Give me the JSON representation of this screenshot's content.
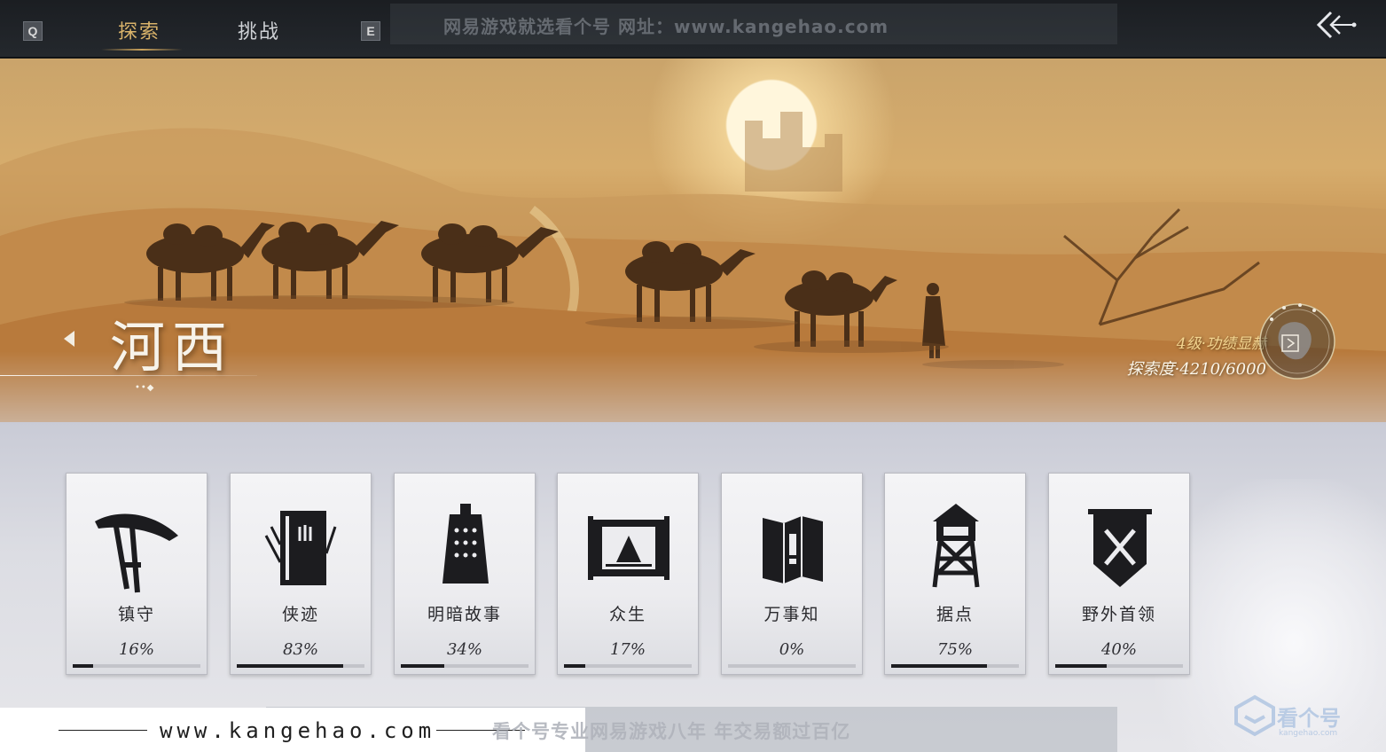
{
  "topbar": {
    "key_left": "Q",
    "key_right": "E",
    "tabs": [
      {
        "label": "探索",
        "active": true
      },
      {
        "label": "挑战",
        "active": false
      }
    ],
    "watermark": "网易游戏就选看个号   网址：www.kangehao.com",
    "back_icon": "double-chevron-left-icon"
  },
  "region": {
    "name": "河西",
    "dots": "••◆",
    "level_text": "4级·功绩显赫",
    "progress_text": "探索度·4210/6000",
    "progress": {
      "current": 4210,
      "total": 6000
    }
  },
  "cards": [
    {
      "title": "镇守",
      "percent_label": "16%",
      "value": 0.16,
      "icon": "straw-hat-swords-icon"
    },
    {
      "title": "侠迹",
      "percent_label": "83%",
      "value": 0.83,
      "icon": "book-bamboo-icon"
    },
    {
      "title": "明暗故事",
      "percent_label": "34%",
      "value": 0.34,
      "icon": "bell-icon"
    },
    {
      "title": "众生",
      "percent_label": "17%",
      "value": 0.17,
      "icon": "scroll-painting-icon"
    },
    {
      "title": "万事知",
      "percent_label": "0%",
      "value": 0.0,
      "icon": "folded-map-icon"
    },
    {
      "title": "据点",
      "percent_label": "75%",
      "value": 0.75,
      "icon": "watchtower-icon"
    },
    {
      "title": "野外首领",
      "percent_label": "40%",
      "value": 0.4,
      "icon": "crossed-swords-banner-icon"
    }
  ],
  "footer": {
    "site": "www.kangehao.com",
    "watermark": "看个号专业网易游戏八年   年交易额过百亿",
    "logo_text": "看个号",
    "logo_sub": "kangehao.com"
  },
  "colors": {
    "active_tab": "#d9b36a",
    "topbar_bg": "#1b1e22",
    "bar_fill": "#1d1d21",
    "level_text": "#f3d590"
  }
}
